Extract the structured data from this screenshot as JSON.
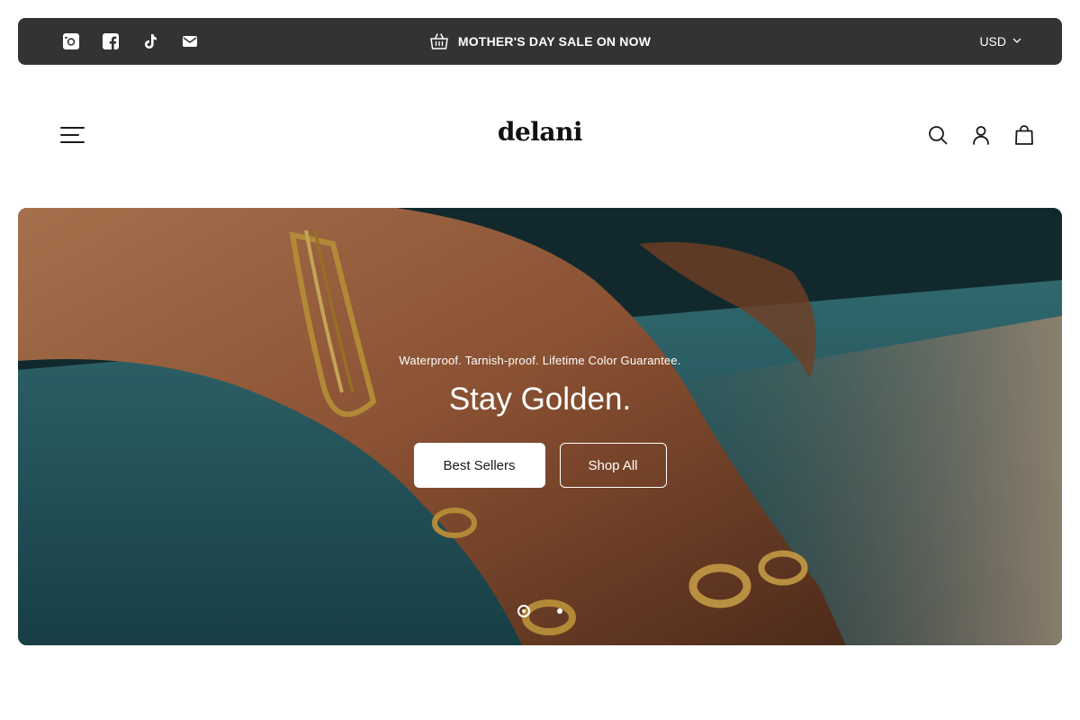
{
  "announcement": {
    "social": [
      {
        "name": "instagram-icon"
      },
      {
        "name": "facebook-icon"
      },
      {
        "name": "tiktok-icon"
      },
      {
        "name": "email-icon"
      }
    ],
    "promo_icon": "basket-icon",
    "promo_text": "MOTHER'S DAY SALE ON NOW",
    "currency": "USD",
    "background_color": "#333333"
  },
  "header": {
    "logo": "delani",
    "icons": [
      "menu-icon",
      "search-icon",
      "account-icon",
      "cart-icon"
    ]
  },
  "hero": {
    "subtitle": "Waterproof. Tarnish-proof. Lifetime Color Guarantee.",
    "title": "Stay Golden.",
    "primary_button": "Best Sellers",
    "secondary_button": "Shop All",
    "slides": {
      "count": 2,
      "active": 1
    }
  }
}
